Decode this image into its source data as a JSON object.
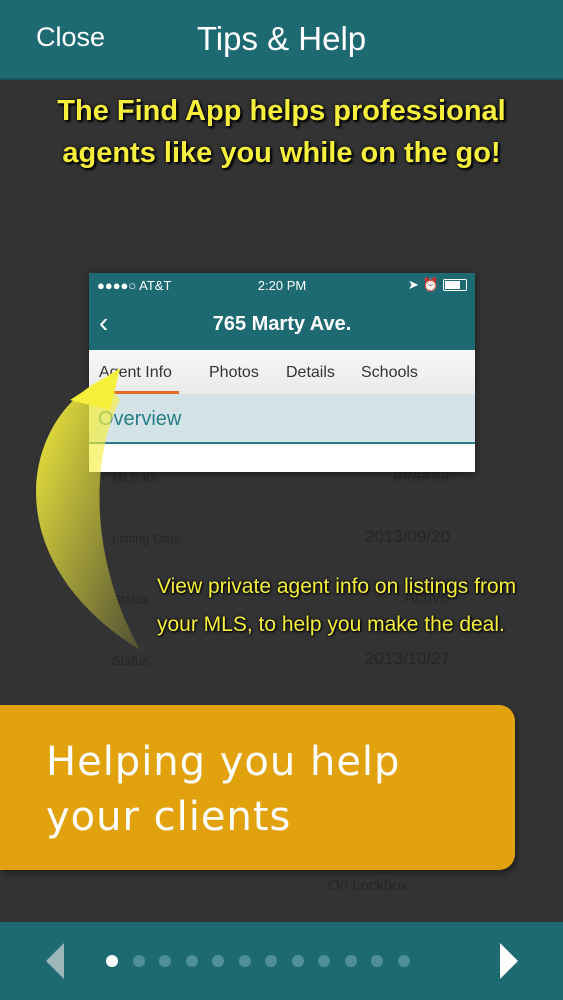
{
  "nav": {
    "close_label": "Close",
    "title": "Tips & Help"
  },
  "headline": "The Find App helps professional agents like you while on the go!",
  "phone_screenshot": {
    "status_carrier": "●●●●○ AT&T",
    "status_time": "2:20 PM",
    "title": "765 Marty Ave.",
    "tabs": [
      "Agent Info",
      "Photos",
      "Details",
      "Schools"
    ],
    "active_tab": "Agent Info",
    "section_header": "Overview"
  },
  "background_listing": {
    "rows": [
      {
        "label": "MLS ID",
        "value": "######"
      },
      {
        "label": "Listing Date",
        "value": "2013/09/20"
      },
      {
        "label": "Status",
        "value": "Active"
      },
      {
        "label": "Status",
        "value": "2013/10/27"
      }
    ],
    "footer_item": "On Lockbox"
  },
  "caption": "View private agent info on listings from your MLS, to help you make the deal.",
  "banner": "Helping you help your clients",
  "pager": {
    "total_pages": 13,
    "current_page": 1
  },
  "colors": {
    "teal": "#1e6a73",
    "yellow": "#f6ef3c",
    "banner": "#e1a20e",
    "tab_underline": "#e46b26"
  },
  "icons": [
    "back-chevron-icon",
    "wifi-icon",
    "location-arrow-icon",
    "alarm-icon",
    "battery-icon",
    "prev-arrow-icon",
    "next-arrow-icon"
  ]
}
